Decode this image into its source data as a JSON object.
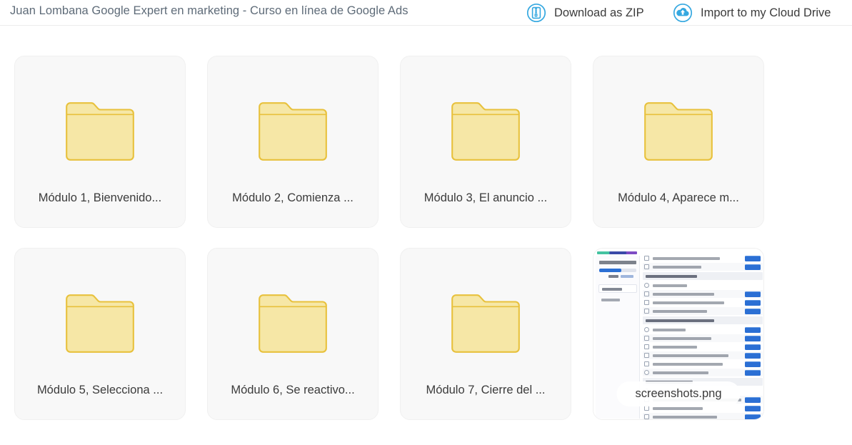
{
  "header": {
    "title": "Juan Lombana Google Expert en marketing - Curso en línea de Google Ads",
    "actions": [
      {
        "label": "Download as ZIP",
        "icon": "zip-download-icon"
      },
      {
        "label": "Import to my Cloud Drive",
        "icon": "cloud-upload-icon"
      }
    ]
  },
  "colors": {
    "accent_blue": "#35a8e0",
    "folder_fill": "#f7e9a8",
    "folder_border": "#e8c13c",
    "card_bg": "#f8f8f8",
    "title_text": "#5e6b78",
    "label_text": "#3b3b3b",
    "thumb_button_blue": "#2b6fd4"
  },
  "items": [
    {
      "name": "Módulo 1, Bienvenido...",
      "type": "folder",
      "icon": "folder-icon"
    },
    {
      "name": "Módulo 2, Comienza ...",
      "type": "folder",
      "icon": "folder-icon"
    },
    {
      "name": "Módulo 3, El anuncio ...",
      "type": "folder",
      "icon": "folder-icon"
    },
    {
      "name": "Módulo 4, Aparece m...",
      "type": "folder",
      "icon": "folder-icon"
    },
    {
      "name": "Módulo 5, Selecciona ...",
      "type": "folder",
      "icon": "folder-icon"
    },
    {
      "name": "Módulo 6, Se reactivo...",
      "type": "folder",
      "icon": "folder-icon"
    },
    {
      "name": "Módulo 7, Cierre del ...",
      "type": "folder",
      "icon": "folder-icon"
    },
    {
      "name": "screenshots.png",
      "type": "image",
      "icon": "image-thumbnail"
    }
  ]
}
